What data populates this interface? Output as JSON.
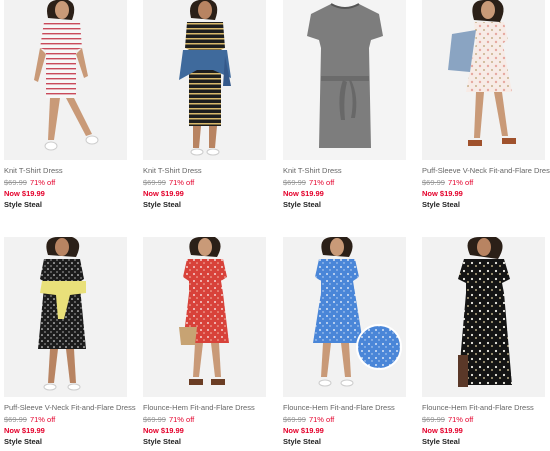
{
  "colors": {
    "sale": "#e4002b",
    "muted": "#999999",
    "text": "#666666",
    "photo_bg": "#f2f2f2"
  },
  "products": [
    {
      "name": "Knit T-Shirt Dress",
      "original_price": "$69.99",
      "discount": "71% off",
      "sale_price": "Now $19.99",
      "badge": "Style Steal",
      "dress_style": "stripe-white"
    },
    {
      "name": "Knit T-Shirt Dress",
      "original_price": "$69.99",
      "discount": "71% off",
      "sale_price": "Now $19.99",
      "badge": "Style Steal",
      "dress_style": "stripe-black"
    },
    {
      "name": "Knit T-Shirt Dress",
      "original_price": "$69.99",
      "discount": "71% off",
      "sale_price": "Now $19.99",
      "badge": "Style Steal",
      "dress_style": "grey-flat"
    },
    {
      "name": "Puff-Sleeve V-Neck Fit-and-Flare Dress",
      "original_price": "$69.99",
      "discount": "71% off",
      "sale_price": "Now $19.99",
      "badge": "Style Steal",
      "dress_style": "floral-light"
    },
    {
      "name": "Puff-Sleeve V-Neck Fit-and-Flare Dress",
      "original_price": "$69.99",
      "discount": "71% off",
      "sale_price": "Now $19.99",
      "badge": "Style Steal",
      "dress_style": "dot-black"
    },
    {
      "name": "Flounce-Hem Fit-and-Flare Dress",
      "original_price": "$69.99",
      "discount": "71% off",
      "sale_price": "Now $19.99",
      "badge": "Style Steal",
      "dress_style": "red-print"
    },
    {
      "name": "Flounce-Hem Fit-and-Flare Dress",
      "original_price": "$69.99",
      "discount": "71% off",
      "sale_price": "Now $19.99",
      "badge": "Style Steal",
      "dress_style": "blue-print"
    },
    {
      "name": "Flounce-Hem Fit-and-Flare Dress",
      "original_price": "$69.99",
      "discount": "71% off",
      "sale_price": "Now $19.99",
      "badge": "Style Steal",
      "dress_style": "black-floral"
    }
  ]
}
